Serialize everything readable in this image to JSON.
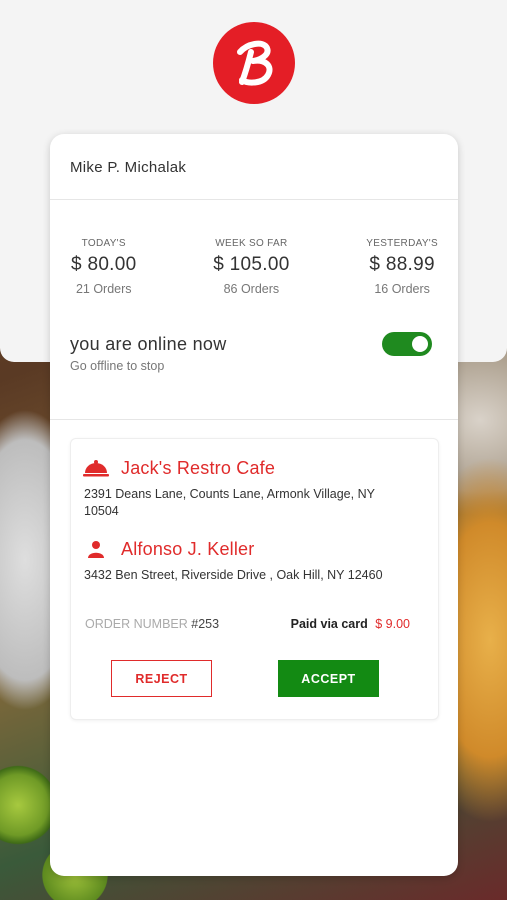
{
  "driver": {
    "name": "Mike P. Michalak"
  },
  "stats": [
    {
      "label": "TODAY'S",
      "amount": "$ 80.00",
      "orders": "21 Orders"
    },
    {
      "label": "WEEK SO FAR",
      "amount": "$ 105.00",
      "orders": "86 Orders"
    },
    {
      "label": "YESTERDAY'S",
      "amount": "$ 88.99",
      "orders": "16 Orders"
    }
  ],
  "status": {
    "title": "you are online now",
    "subtitle": "Go offline to stop",
    "online": true
  },
  "order": {
    "restaurant": {
      "name": "Jack's Restro Cafe",
      "address": "2391 Deans Lane, Counts Lane, Armonk Village, NY 10504",
      "icon": "cloche-icon"
    },
    "customer": {
      "name": "Alfonso J. Keller",
      "address": "3432 Ben Street, Riverside Drive , Oak Hill, NY 12460",
      "icon": "person-icon"
    },
    "order_number_label": "ORDER NUMBER",
    "order_number": "#253",
    "payment_label": "Paid via card",
    "payment_amount": "$ 9.00",
    "reject_label": "REJECT",
    "accept_label": "ACCEPT"
  },
  "colors": {
    "brand": "#e41e26",
    "accent_red": "#e02b2b",
    "accept_green": "#138a13",
    "toggle_green": "#1f8a1f"
  }
}
